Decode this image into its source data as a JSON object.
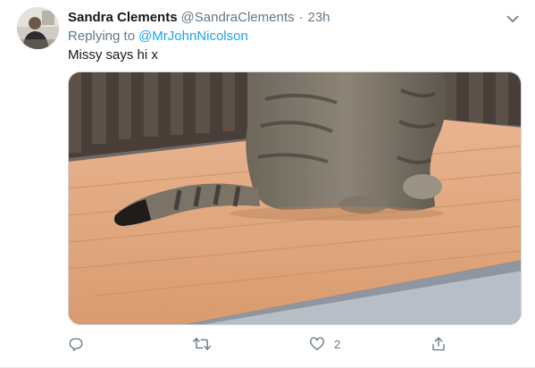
{
  "tweet": {
    "author_name": "Sandra Clements",
    "author_handle": "@SandraClements",
    "separator": "·",
    "time": "23h",
    "replying_to_label": "Replying to",
    "replying_to_handle": "@MrJohnNicolson",
    "text": "Missy says hi x",
    "media_description": "photo of a tabby cat sitting on a wooden table",
    "actions": {
      "reply_count": "",
      "retweet_count": "",
      "like_count": "2",
      "share_count": ""
    }
  },
  "icons": [
    "caret-down-icon",
    "reply-icon",
    "retweet-icon",
    "like-icon",
    "share-icon"
  ],
  "colors": {
    "link": "#1da1f2",
    "secondary_text": "#657786",
    "primary_text": "#14171a",
    "border": "#e6ecf0"
  }
}
